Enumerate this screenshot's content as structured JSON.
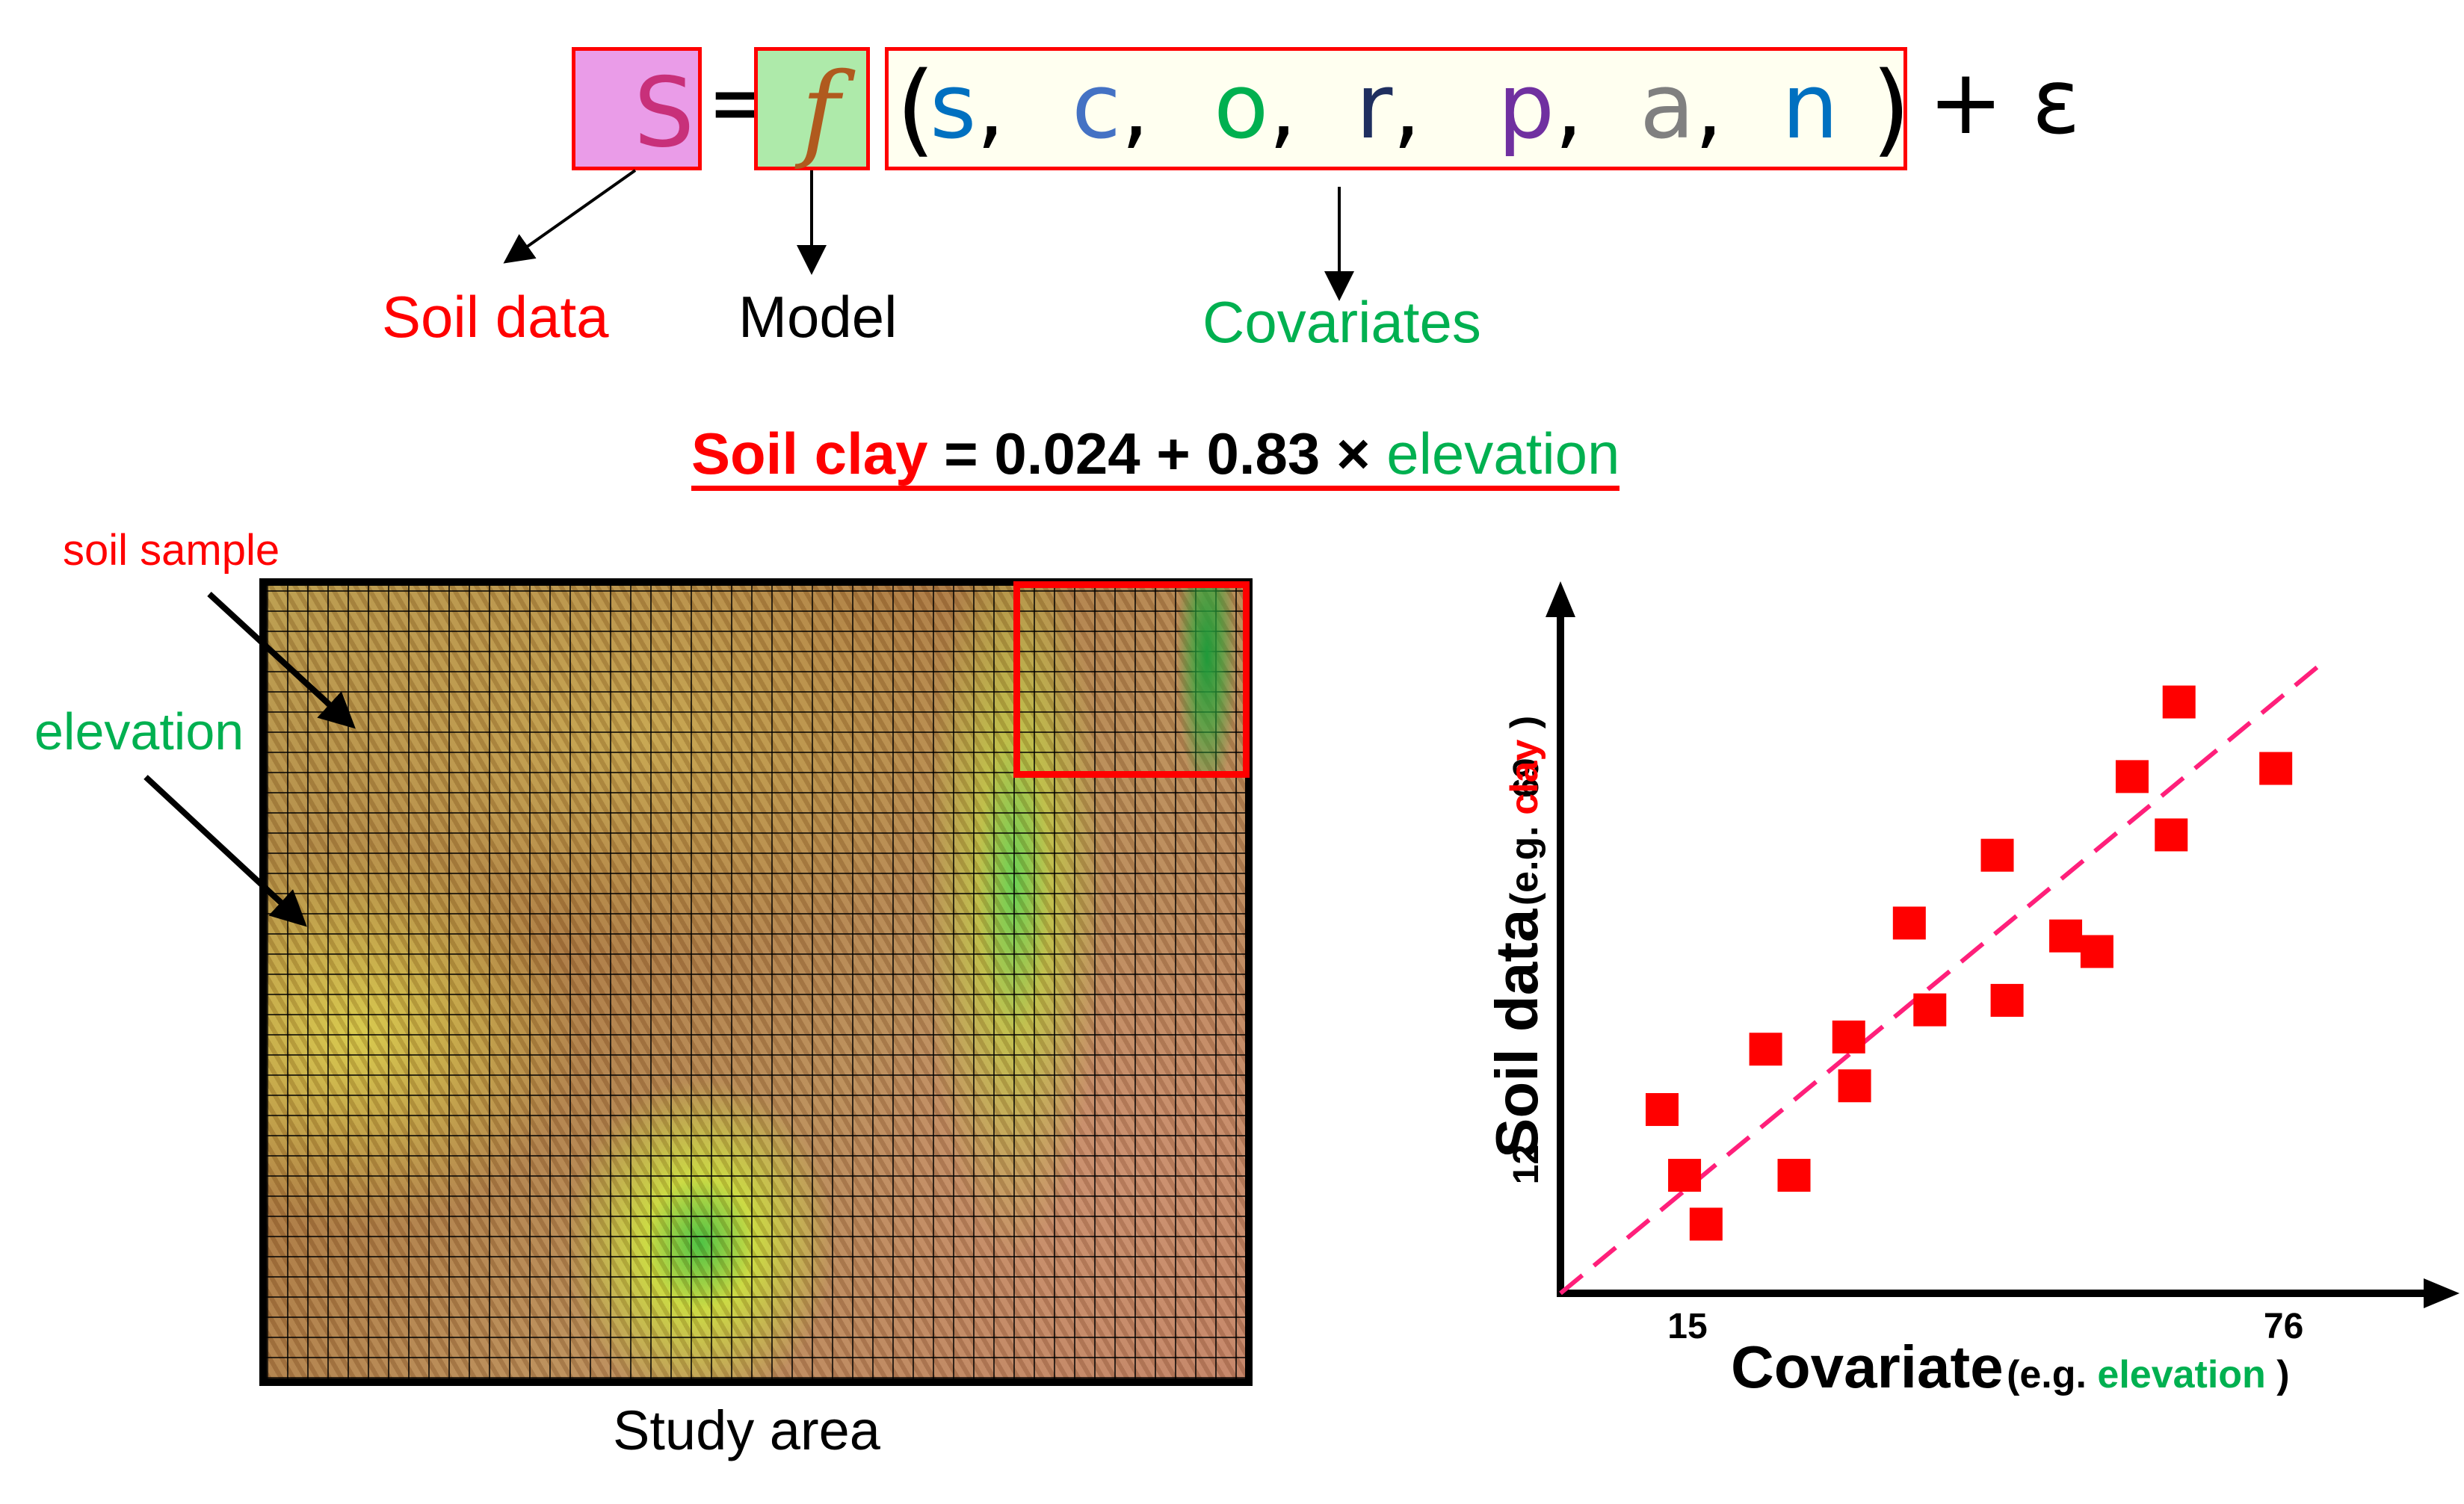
{
  "formula": {
    "lhs": "S",
    "equals": "=",
    "model": "f",
    "open_paren": "(",
    "close_paren": ")",
    "terms": [
      {
        "letter": "s",
        "sep": ",",
        "color": "#0070c0"
      },
      {
        "letter": "c",
        "sep": ",",
        "color": "#4472c4"
      },
      {
        "letter": "o",
        "sep": ",",
        "color": "#00b050"
      },
      {
        "letter": "r",
        "sep": ",",
        "color": "#1f2f5f"
      },
      {
        "letter": "p",
        "sep": ",",
        "color": "#7030a0"
      },
      {
        "letter": "a",
        "sep": ",",
        "color": "#808080"
      },
      {
        "letter": "n",
        "sep": "",
        "color": "#0070c0"
      }
    ],
    "error": "+ ε",
    "colors": {
      "lhs_bg": "#ea9ce8",
      "lhs_text": "#c8307a",
      "model_bg": "#aeeaaa",
      "model_text": "#b05a1e",
      "cov_bg": "#fffff0",
      "box_border": "#ff0000"
    }
  },
  "labels": {
    "soil_data": "Soil data",
    "model": "Model",
    "covariates": "Covariates"
  },
  "equation": {
    "lhs": "Soil clay",
    "middle": " = 0.024 + 0.83 × ",
    "rhs": "elevation"
  },
  "map": {
    "soil_sample_label": "soil sample",
    "elevation_label": "elevation",
    "caption": "Study area"
  },
  "chart_data": {
    "type": "scatter",
    "xlabel": "Covariate",
    "xlabel_note_prefix": "(e.g. ",
    "xlabel_note_highlight": "elevation",
    "xlabel_note_suffix": " )",
    "ylabel": "Soil data",
    "ylabel_note_prefix": "(e.g. ",
    "ylabel_note_highlight": "clay",
    "ylabel_note_suffix": " )",
    "xticks": [
      15,
      76
    ],
    "yticks": [
      12,
      69
    ],
    "xlim": [
      2,
      94
    ],
    "ylim": [
      -7,
      98
    ],
    "grid": false,
    "marker_color": "#ff0000",
    "fit_line_color": "#ff1f7a",
    "fit_line": {
      "x": [
        2,
        80
      ],
      "y": [
        -7,
        86
      ]
    },
    "points": [
      [
        12.4,
        20.1
      ],
      [
        14.7,
        10.4
      ],
      [
        16.9,
        3.2
      ],
      [
        23.0,
        29.0
      ],
      [
        25.9,
        10.4
      ],
      [
        31.5,
        30.8
      ],
      [
        32.1,
        23.6
      ],
      [
        37.7,
        47.6
      ],
      [
        39.8,
        34.8
      ],
      [
        46.7,
        57.6
      ],
      [
        47.7,
        36.2
      ],
      [
        53.7,
        45.7
      ],
      [
        56.9,
        43.4
      ],
      [
        60.5,
        69.2
      ],
      [
        64.5,
        60.6
      ],
      [
        65.3,
        80.2
      ],
      [
        75.2,
        70.4
      ]
    ]
  }
}
